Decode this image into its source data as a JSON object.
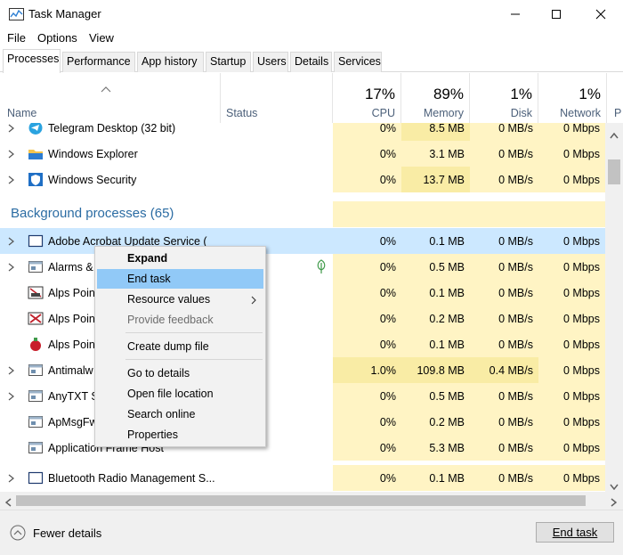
{
  "window": {
    "title": "Task Manager",
    "app_icon": "task-manager-icon"
  },
  "menu": [
    "File",
    "Options",
    "View"
  ],
  "tabs": [
    {
      "label": "Processes",
      "active": true
    },
    {
      "label": "Performance",
      "active": false
    },
    {
      "label": "App history",
      "active": false
    },
    {
      "label": "Startup",
      "active": false
    },
    {
      "label": "Users",
      "active": false
    },
    {
      "label": "Details",
      "active": false
    },
    {
      "label": "Services",
      "active": false
    }
  ],
  "columns": {
    "name": "Name",
    "status": "Status",
    "cpu": {
      "pct": "17%",
      "label": "CPU"
    },
    "memory": {
      "pct": "89%",
      "label": "Memory"
    },
    "disk": {
      "pct": "1%",
      "label": "Disk"
    },
    "network": {
      "pct": "1%",
      "label": "Network"
    },
    "overflow": "P"
  },
  "apps_rows": [
    {
      "name": "Telegram Desktop (32 bit)",
      "icon": "telegram-icon",
      "cpu": "0%",
      "memory": "8.5 MB",
      "disk": "0 MB/s",
      "network": "0 Mbps"
    },
    {
      "name": "Windows Explorer",
      "icon": "folder-icon",
      "cpu": "0%",
      "memory": "3.1 MB",
      "disk": "0 MB/s",
      "network": "0 Mbps"
    },
    {
      "name": "Windows Security",
      "icon": "shield-icon",
      "cpu": "0%",
      "memory": "13.7 MB",
      "disk": "0 MB/s",
      "network": "0 Mbps"
    }
  ],
  "background_group": {
    "title": "Background processes (65)"
  },
  "background_rows": [
    {
      "name": "Adobe Acrobat Update Service (",
      "icon": "window-icon",
      "cpu": "0%",
      "memory": "0.1 MB",
      "disk": "0 MB/s",
      "network": "0 Mbps",
      "selected": true
    },
    {
      "name": "Alarms &",
      "icon": "app-window-icon",
      "cpu": "0%",
      "memory": "0.5 MB",
      "disk": "0 MB/s",
      "network": "0 Mbps",
      "status_icon": "leaf-icon"
    },
    {
      "name": "Alps Poin",
      "icon": "alps-pointing-icon",
      "cpu": "0%",
      "memory": "0.1 MB",
      "disk": "0 MB/s",
      "network": "0 Mbps"
    },
    {
      "name": "Alps Poin",
      "icon": "alps-pointing-x-icon",
      "cpu": "0%",
      "memory": "0.2 MB",
      "disk": "0 MB/s",
      "network": "0 Mbps"
    },
    {
      "name": "Alps Poin",
      "icon": "alps-pointing-red-icon",
      "cpu": "0%",
      "memory": "0.1 MB",
      "disk": "0 MB/s",
      "network": "0 Mbps"
    },
    {
      "name": "Antimalw",
      "icon": "app-window-icon",
      "cpu": "1.0%",
      "memory": "109.8 MB",
      "disk": "0.4 MB/s",
      "network": "0 Mbps"
    },
    {
      "name": "AnyTXT S",
      "icon": "app-window-icon",
      "cpu": "0%",
      "memory": "0.5 MB",
      "disk": "0 MB/s",
      "network": "0 Mbps"
    },
    {
      "name": "ApMsgFw",
      "icon": "app-window-icon",
      "cpu": "0%",
      "memory": "0.2 MB",
      "disk": "0 MB/s",
      "network": "0 Mbps"
    },
    {
      "name": "Application Frame Host",
      "icon": "app-window-icon",
      "cpu": "0%",
      "memory": "5.3 MB",
      "disk": "0 MB/s",
      "network": "0 Mbps"
    },
    {
      "name": "Bluetooth Radio Management S...",
      "icon": "window-icon",
      "cpu": "0%",
      "memory": "0.1 MB",
      "disk": "0 MB/s",
      "network": "0 Mbps"
    }
  ],
  "context_menu": {
    "items": [
      {
        "label": "Expand",
        "bold": true
      },
      {
        "label": "End task",
        "highlighted": true
      },
      {
        "label": "Resource values",
        "submenu": true
      },
      {
        "label": "Provide feedback",
        "disabled": true
      },
      {
        "label": "Create dump file"
      },
      {
        "label": "Go to details"
      },
      {
        "label": "Open file location"
      },
      {
        "label": "Search online"
      },
      {
        "label": "Properties"
      }
    ]
  },
  "footer": {
    "fewer_details": "Fewer details",
    "end_task": "End task"
  },
  "colors": {
    "accent_selected": "#cce8ff",
    "menu_highlight": "#91c9f7",
    "heat_light": "#fff4c4",
    "heat_medium": "#f9eca5",
    "heat_strong": "#ffd980",
    "group_title": "#2b6ca3"
  }
}
